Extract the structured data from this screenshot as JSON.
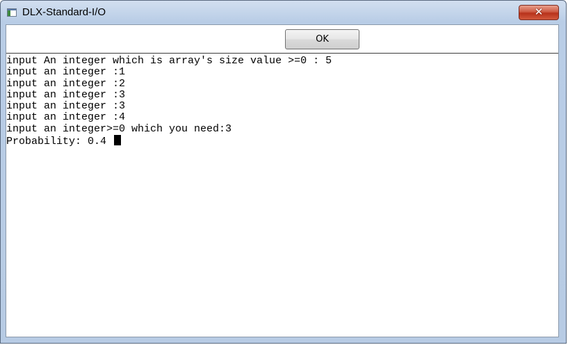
{
  "window": {
    "title": "DLX-Standard-I/O",
    "close_symbol": "✕"
  },
  "toolbar": {
    "ok_label": "OK"
  },
  "console": {
    "lines": [
      "input An integer which is array's size value >=0 : 5",
      "input an integer :1",
      "input an integer :2",
      "input an integer :3",
      "input an integer :3",
      "input an integer :4",
      "input an integer>=0 which you need:3",
      "Probability: 0.4 "
    ]
  },
  "icons": {
    "app": "window-app-icon",
    "close": "close-icon",
    "cursor": "text-cursor-block"
  }
}
